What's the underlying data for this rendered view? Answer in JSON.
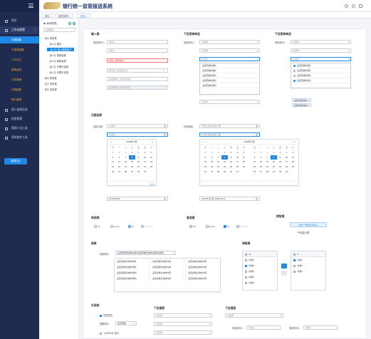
{
  "app": {
    "title": "银行统一监管报送系统"
  },
  "sidebar": {
    "items": [
      {
        "label": "首页"
      },
      {
        "label": "工作台配置"
      },
      {
        "label": "录表配置"
      },
      {
        "label": "子表录配置"
      },
      {
        "label": "工作日志"
      },
      {
        "label": "报表监测"
      },
      {
        "label": "文件管理"
      },
      {
        "label": "冲表配置"
      },
      {
        "label": "稽行管理"
      },
      {
        "label": "填入报表信息"
      },
      {
        "label": "权限管理"
      },
      {
        "label": "管理人员工具"
      },
      {
        "label": "系统维护工具"
      }
    ],
    "bottom_button": "数据过滤"
  },
  "tabs": [
    "首页",
    "报表管理 ×",
    "控件 ×"
  ],
  "tree": {
    "title": "树状导航",
    "select_value": "选择报表",
    "nodes": [
      "【A】的系表",
      "【A-1】报生",
      "【A-1】录入报表资产",
      "【A-1】资报证券",
      "【A-1】其他证券",
      "【A-1】代理行证券",
      "【A-1】代理行证券",
      "【B】的系表",
      "【C】的系表",
      "【D】的系表"
    ]
  },
  "inputs": {
    "section_input": "输入框",
    "section_dropdown1": "下拉菜单单选",
    "section_dropdown2": "下拉菜单单选",
    "label1": "筛选条件1：",
    "ph_input": "请输入",
    "ph_select": "请选择",
    "err_text": "请输入错误信息",
    "err_hint": "提示输入的错误信息",
    "disabled_text": "请查看输入的测试内容",
    "normal_text": "请查看输入的测试内容",
    "dd1_items": [
      "设置查看内容1",
      "设置查看内容2",
      "设置查看内容3",
      "设置查看内容4",
      "设置查看内容5"
    ],
    "dd2_items": [
      "设置查看内容1",
      "设置查看内容2",
      "设置查看内容3",
      "设置查看内容4"
    ],
    "chips": [
      "设置查看内容1 ×",
      "设置查看内容2 ×"
    ]
  },
  "dates": {
    "section": "日期选择",
    "label_single": "选择日期：",
    "label_range": "时间选择：",
    "ph_date": "请选择",
    "ph_range": "开始日期至结束日期",
    "cal1_title": "2018年  8月",
    "cal2_title": "2018年  8月",
    "weekdays": [
      "日",
      "一",
      "二",
      "三",
      "四",
      "五",
      "六"
    ],
    "days_muted_head": [
      "29",
      "30",
      "31"
    ],
    "days": [
      "1",
      "2",
      "3",
      "4",
      "5",
      "6",
      "7",
      "8",
      "9",
      "10",
      "11",
      "12",
      "13",
      "14",
      "15",
      "16",
      "17",
      "18",
      "19",
      "20",
      "21",
      "22",
      "23",
      "24",
      "25",
      "26",
      "27",
      "28",
      "29",
      "30",
      "31"
    ],
    "today": "8",
    "foot_text": "今天",
    "value1": "2018-08-08",
    "value2": "2018-8-08 至 2018-08-21"
  },
  "radios": {
    "section_radio": "单选框",
    "section_check": "复选框",
    "section_btn": "按钮框",
    "options": [
      "pff",
      "Hover",
      "on",
      "Disabled"
    ],
    "btn_primary": "还有一按钮文字输入",
    "btn_ghost": "气泡显示框"
  },
  "cascade": {
    "section": "级联",
    "label": "筛选条件：",
    "value": "设置查看查询的内容/设置查看查询的内容/设置查...",
    "col_items": [
      "设置查看查询的内容1",
      "设置查看查询的内容2",
      "设置查看查询的内容3",
      "设置查看查询的内容4"
    ],
    "col2_items": [
      "设置查看查询的内容",
      "设置查看查询的内容",
      "设置查看查询的内容",
      "设置查看查询的内容"
    ],
    "col3_items": [
      "设置查看查询的内容",
      "设置查看查询的内容",
      "设置查看查询的内容",
      "设置查看查询的内容"
    ]
  },
  "transfer": {
    "section": "穿梭框",
    "left_header": "10",
    "right_header": "6",
    "left_items": [
      "内容1",
      "内容2",
      "内容3",
      "内容4",
      "内容5"
    ],
    "right_items": [
      "内容1",
      "内容2",
      "内容3"
    ]
  },
  "bottom": {
    "section_tree": "多选树",
    "section_dd1": "下拉搜索",
    "section_dd2": "下拉搜索",
    "tree_root": "任意成员",
    "tree_label": "根据条件：",
    "tree_value": "监管报送",
    "tree_sub": "【X0000】统计",
    "ph_select": "请选择",
    "label1": "筛选条件1：",
    "ph_input": "请输入"
  }
}
